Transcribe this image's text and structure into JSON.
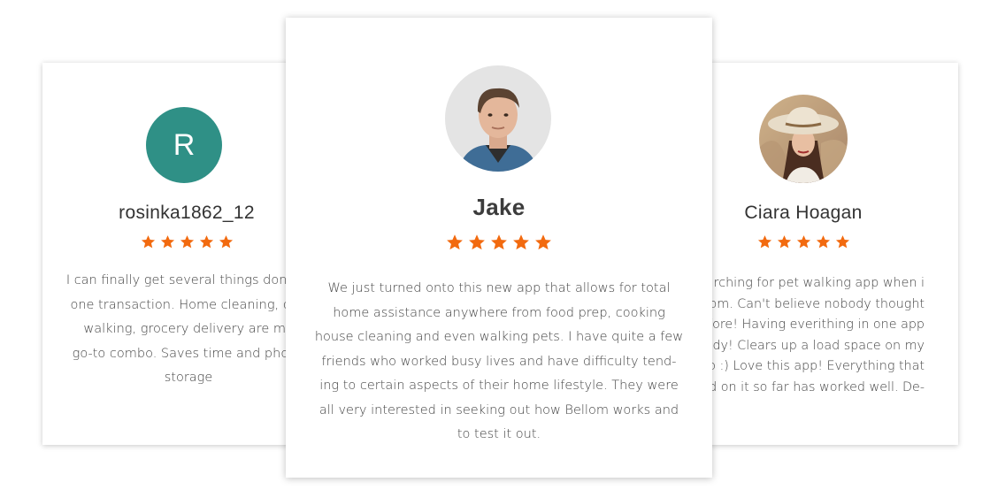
{
  "colors": {
    "star": "#f26a0f",
    "letter_avatar_bg": "#2f9086",
    "card_bg": "#ffffff"
  },
  "cards": [
    {
      "avatar_letter": "R",
      "name": "rosinka1862_12",
      "rating": 5,
      "review_lines": [
        "I can finally get several things done in",
        "one transaction. Home cleaning, dog",
        "walking, grocery delivery are my",
        "go-to combo. Saves time and phone",
        "storage"
      ]
    },
    {
      "avatar_icon": "man-portrait-photo",
      "name": "Jake",
      "rating": 5,
      "review_lines": [
        "We just turned onto this new app that allows for total",
        "home assistance anywhere from food prep, cooking",
        "house cleaning and even walking pets. I have quite a few",
        "friends who worked busy lives and have difficulty tend-",
        "ing to certain aspects of their home lifestyle. They were",
        "all very interested in seeking out how Bellom works and",
        "to test it out."
      ]
    },
    {
      "avatar_icon": "woman-in-hat-portrait-photo",
      "name": "Ciara Hoagan",
      "rating": 5,
      "review_lines": [
        "arching for pet walking app when i",
        "ellom. Can't believe nobody thought",
        "before! Having everithing in one app",
        "handy! Clears up a load space on my",
        "too :) Love this app! Everything that",
        "ed on it so far has worked well. De-"
      ]
    }
  ]
}
